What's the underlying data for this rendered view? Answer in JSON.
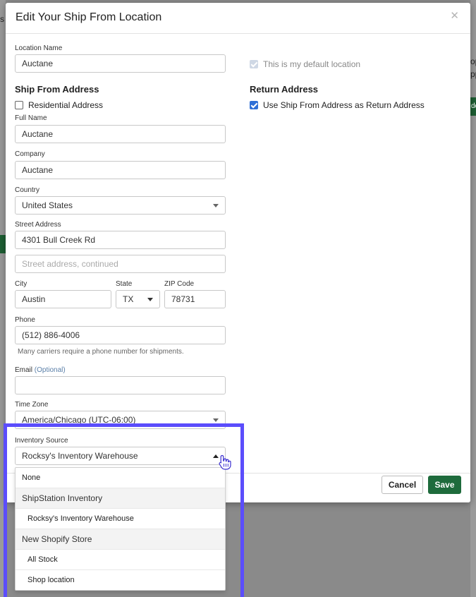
{
  "background": {
    "left_letter": "s",
    "right_letters": [
      "op",
      "pp"
    ],
    "right_green_text": "do"
  },
  "modal": {
    "title": "Edit Your Ship From Location",
    "close_icon": "close-icon",
    "location_name": {
      "label": "Location Name",
      "value": "Auctane"
    },
    "default_location": {
      "label": "This is my default location",
      "checked": true,
      "disabled": true
    },
    "ship_from": {
      "title": "Ship From Address",
      "residential": {
        "label": "Residential Address",
        "checked": false
      },
      "full_name": {
        "label": "Full Name",
        "value": "Auctane"
      },
      "company": {
        "label": "Company",
        "value": "Auctane"
      },
      "country": {
        "label": "Country",
        "value": "United States"
      },
      "street": {
        "label": "Street Address",
        "value": "4301 Bull Creek Rd"
      },
      "street2": {
        "placeholder": "Street address, continued",
        "value": ""
      },
      "city": {
        "label": "City",
        "value": "Austin"
      },
      "state": {
        "label": "State",
        "value": "TX"
      },
      "zip": {
        "label": "ZIP Code",
        "value": "78731"
      },
      "phone": {
        "label": "Phone",
        "value": "(512) 886-4006",
        "hint": "Many carriers require a phone number for shipments."
      },
      "email": {
        "label": "Email",
        "optional": "(Optional)",
        "value": ""
      },
      "timezone": {
        "label": "Time Zone",
        "value": "America/Chicago (UTC-06:00)"
      },
      "inventory_source": {
        "label": "Inventory Source",
        "value": "Rocksy's Inventory Warehouse"
      }
    },
    "return_address": {
      "title": "Return Address",
      "use_ship_from": {
        "label": "Use Ship From Address as Return Address",
        "checked": true
      }
    },
    "footer": {
      "cancel_label": "Cancel",
      "save_label": "Save"
    }
  },
  "dropdown": {
    "options": [
      {
        "label": "None",
        "type": "item"
      },
      {
        "label": "ShipStation Inventory",
        "type": "group"
      },
      {
        "label": "Rocksy's Inventory Warehouse",
        "type": "child"
      },
      {
        "label": "New Shopify Store",
        "type": "group"
      },
      {
        "label": "All Stock",
        "type": "child"
      },
      {
        "label": "Shop location",
        "type": "child"
      }
    ]
  },
  "colors": {
    "accent": "#2f6fd6",
    "save": "#1e6b3c",
    "highlight": "#5b4dfc"
  },
  "cursor_icon": "hand-pointer-icon"
}
